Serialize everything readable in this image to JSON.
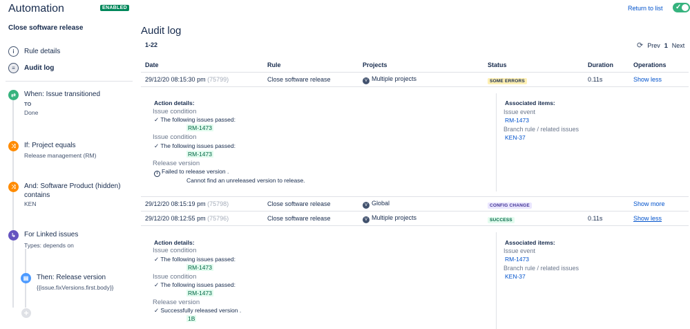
{
  "app": {
    "title": "Automation",
    "status_badge": "ENABLED",
    "return_link": "Return to list",
    "toggle_check": "✓"
  },
  "sidebar": {
    "rule_name": "Close software release",
    "nav": [
      {
        "label": "Rule details",
        "icon": "info-icon",
        "glyph": "i"
      },
      {
        "label": "Audit log",
        "icon": "list-icon",
        "glyph": "≡"
      }
    ],
    "steps": [
      {
        "title": "When: Issue transitioned",
        "sub1": "TO",
        "sub2": "Done",
        "color": "#36B37E",
        "glyph": "⇄",
        "icon": "trigger-icon"
      },
      {
        "title": "If: Project equals",
        "sub1": "Release management (RM)",
        "color": "#FF8B00",
        "glyph": "⤨",
        "icon": "condition-icon"
      },
      {
        "title": "And: Software Product (hidden) contains",
        "sub1": "KEN",
        "color": "#FF8B00",
        "glyph": "⤨",
        "icon": "condition-icon"
      },
      {
        "title": "For Linked issues",
        "sub1": "Types: depends on",
        "color": "#6554C0",
        "glyph": "↳",
        "icon": "branch-icon"
      },
      {
        "title": "Then: Release version",
        "sub1": "{{issue.fixVersions.first.body}}",
        "color": "#4C9AFF",
        "glyph": "▤",
        "icon": "action-icon"
      }
    ],
    "add_glyph": "+"
  },
  "main": {
    "title": "Audit log",
    "range": "1-22",
    "pager": {
      "refresh_glyph": "⟳",
      "prev": "Prev",
      "current": "1",
      "next": "Next"
    },
    "columns": [
      "Date",
      "Rule",
      "Projects",
      "Status",
      "Duration",
      "Operations"
    ],
    "rows": [
      {
        "date": "29/12/20 08:15:30 pm",
        "id": "(75799)",
        "rule": "Close software release",
        "projects": "Multiple projects",
        "status": "SOME ERRORS",
        "duration": "0.11s",
        "op": "Show less"
      },
      {
        "date": "29/12/20 08:15:19 pm",
        "id": "(75798)",
        "rule": "Close software release",
        "projects": "Global",
        "status": "CONFIG CHANGE",
        "duration": "",
        "op": "Show more"
      },
      {
        "date": "29/12/20 08:12:55 pm",
        "id": "(75796)",
        "rule": "Close software release",
        "projects": "Multiple projects",
        "status": "SUCCESS",
        "duration": "0.11s",
        "op": "Show less"
      }
    ],
    "project_glyph": "V",
    "details": [
      {
        "action_heading": "Action details:",
        "cond1_label": "Issue condition",
        "cond1_text": "✓ The following issues passed:",
        "cond1_key": "RM-1473",
        "cond2_label": "Issue condition",
        "cond2_text": "✓ The following issues passed:",
        "cond2_key": "RM-1473",
        "release_label": "Release version",
        "release_text": "Failed to release version .",
        "release_text2": "Cannot find an unreleased version to release.",
        "assoc_heading": "Associated items:",
        "assoc_event_label": "Issue event",
        "assoc_event_link": "RM-1473",
        "assoc_branch_label": "Branch rule / related issues",
        "assoc_branch_link": "KEN-37"
      },
      {
        "action_heading": "Action details:",
        "cond1_label": "Issue condition",
        "cond1_text": "✓ The following issues passed:",
        "cond1_key": "RM-1473",
        "cond2_label": "Issue condition",
        "cond2_text": "✓ The following issues passed:",
        "cond2_key": "RM-1473",
        "release_label": "Release version",
        "release_text": "✓ Successfully released version .",
        "release_key": "1B",
        "assoc_heading": "Associated items:",
        "assoc_event_label": "Issue event",
        "assoc_event_link": "RM-1473",
        "assoc_branch_label": "Branch rule / related issues",
        "assoc_branch_link": "KEN-37"
      }
    ]
  },
  "colors": {
    "accent": "#0052CC",
    "enabled": "#00875A",
    "toggle": "#36B37E"
  }
}
